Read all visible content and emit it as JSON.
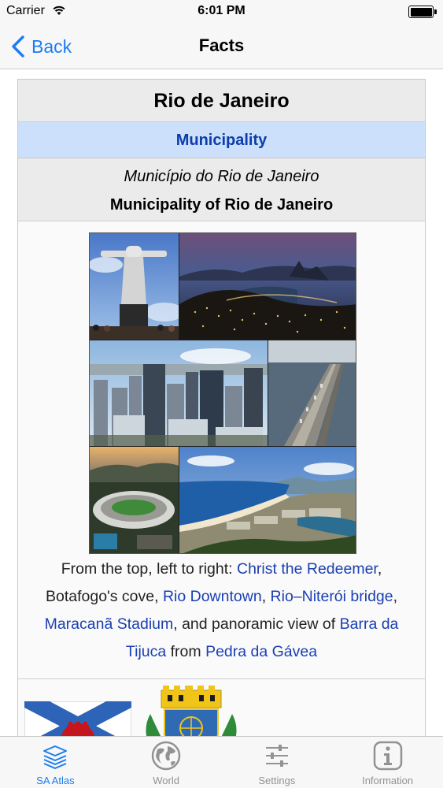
{
  "status_bar": {
    "carrier": "Carrier",
    "time": "6:01 PM"
  },
  "nav": {
    "back_label": "Back",
    "title": "Facts"
  },
  "infobox": {
    "title": "Rio de Janeiro",
    "type": "Municipality",
    "native_name": "Município do Rio de Janeiro",
    "english_name": "Municipality of Rio de Janeiro",
    "caption": [
      {
        "text": "From the top, left to right: ",
        "link": false
      },
      {
        "text": "Christ the Redeemer",
        "link": true
      },
      {
        "text": ", Botafogo's cove, ",
        "link": false
      },
      {
        "text": "Rio Downtown",
        "link": true
      },
      {
        "text": ", ",
        "link": false
      },
      {
        "text": "Rio–Niterói bridge",
        "link": true
      },
      {
        "text": ", ",
        "link": false
      },
      {
        "text": "Maracanã Stadium",
        "link": true
      },
      {
        "text": ", and panoramic view of ",
        "link": false
      },
      {
        "text": "Barra da Tijuca",
        "link": true
      },
      {
        "text": " from ",
        "link": false
      },
      {
        "text": "Pedra da Gávea",
        "link": true
      }
    ]
  },
  "tab_bar": {
    "active_index": 0,
    "items": [
      {
        "label": "SA Atlas",
        "icon": "layers-icon"
      },
      {
        "label": "World",
        "icon": "globe-icon"
      },
      {
        "label": "Settings",
        "icon": "sliders-icon"
      },
      {
        "label": "Information",
        "icon": "info-icon"
      }
    ]
  },
  "colors": {
    "accent": "#1b7cf5",
    "link": "#1a3fb1",
    "municipality_header_bg": "#cce0fb",
    "municipality_header_text": "#0b3dab",
    "tab_inactive": "#929292"
  }
}
